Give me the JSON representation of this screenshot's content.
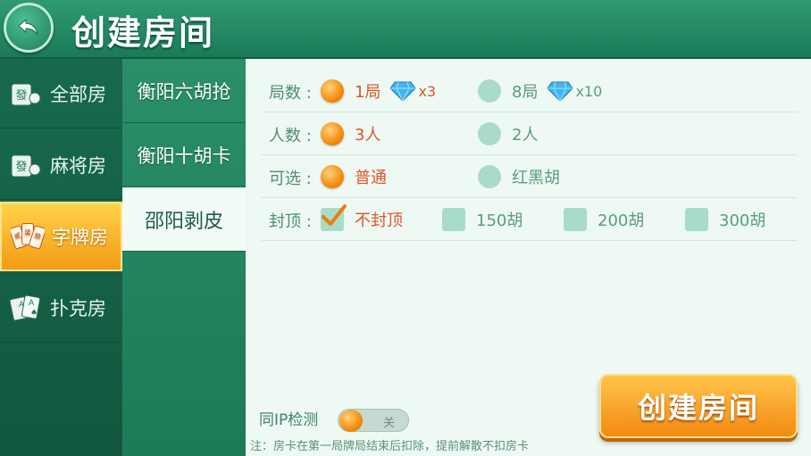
{
  "header": {
    "title": "创建房间"
  },
  "categories": [
    {
      "label": "全部房",
      "icon": "mahjong-tile-icon"
    },
    {
      "label": "麻将房",
      "icon": "mahjong-tile-icon"
    },
    {
      "label": "字牌房",
      "icon": "zipai-cards-icon",
      "active": true,
      "card_text": [
        "贰",
        "柒",
        "拾"
      ]
    },
    {
      "label": "扑克房",
      "icon": "poker-cards-icon"
    }
  ],
  "games": [
    {
      "label": "衡阳六胡抢"
    },
    {
      "label": "衡阳十胡卡"
    },
    {
      "label": "邵阳剥皮",
      "active": true
    }
  ],
  "options": {
    "rounds": {
      "label": "局数 :",
      "choices": [
        {
          "text": "1局",
          "selected": true,
          "cost": "x3"
        },
        {
          "text": "8局",
          "selected": false,
          "cost": "x10"
        }
      ]
    },
    "players": {
      "label": "人数 :",
      "choices": [
        {
          "text": "3人",
          "selected": true
        },
        {
          "text": "2人",
          "selected": false
        }
      ]
    },
    "optional": {
      "label": "可选 :",
      "choices": [
        {
          "text": "普通",
          "selected": true
        },
        {
          "text": "红黑胡",
          "selected": false
        }
      ]
    },
    "cap": {
      "label": "封顶 :",
      "choices": [
        {
          "text": "不封顶",
          "selected": true
        },
        {
          "text": "150胡",
          "selected": false
        },
        {
          "text": "200胡",
          "selected": false
        },
        {
          "text": "300胡",
          "selected": false
        }
      ]
    }
  },
  "ip_check": {
    "label": "同IP检测",
    "state": "关"
  },
  "note": "注：房卡在第一局牌局结束后扣除，提前解散不扣房卡",
  "create_button": "创建房间",
  "colors": {
    "accent_orange": "#f58c0c",
    "selected_text": "#e0552b",
    "panel_bg": "#eef9f4",
    "header_green": "#2f9a72"
  }
}
